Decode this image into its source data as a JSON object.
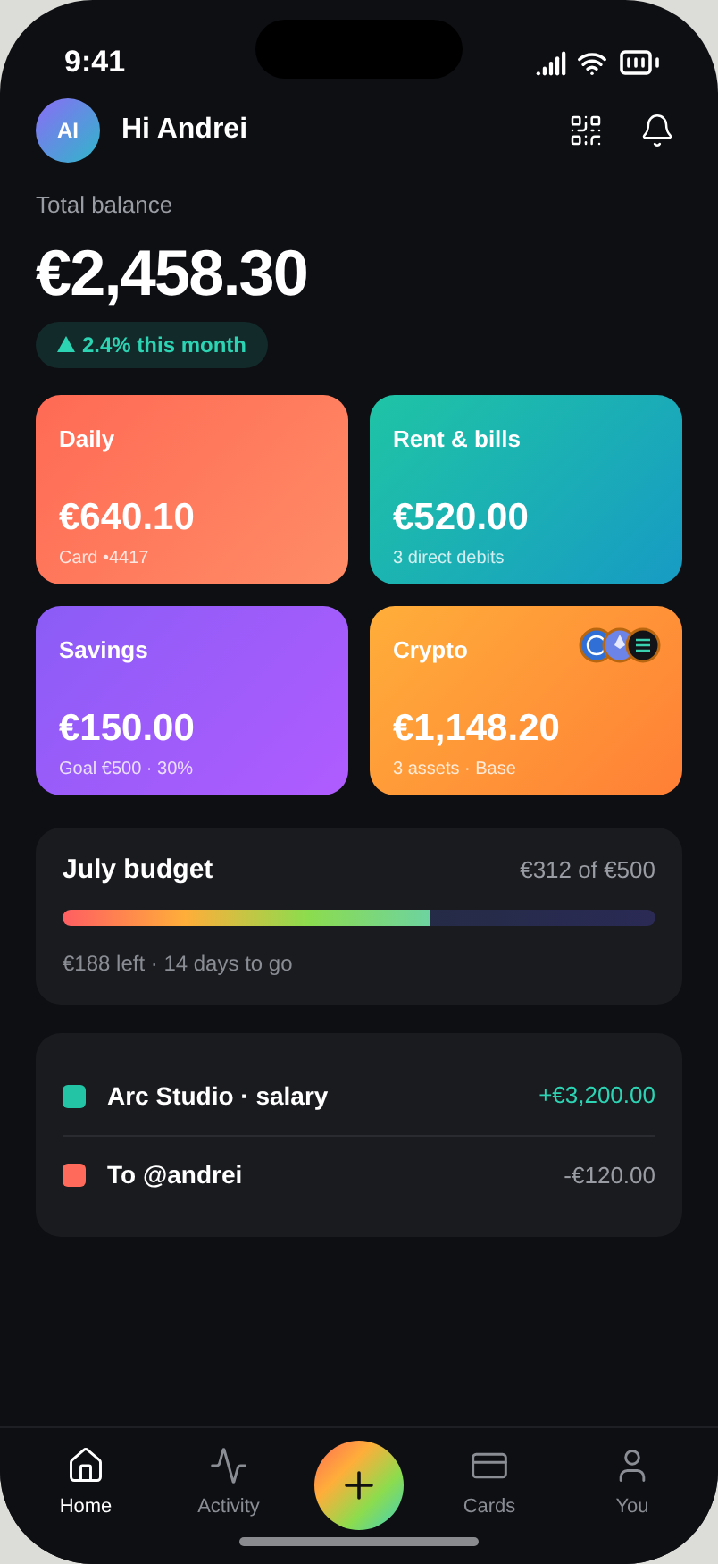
{
  "status_bar": {
    "time": "9:41"
  },
  "header": {
    "avatar_initials": "AI",
    "greeting": "Hi Andrei"
  },
  "balance": {
    "label": "Total balance",
    "amount": "€2,458.30",
    "change": "2.4% this month"
  },
  "accounts": [
    {
      "name": "Daily",
      "amount": "€640.10",
      "detail": "Card •4417",
      "color": "#ff6a55"
    },
    {
      "name": "Rent & bills",
      "amount": "€520.00",
      "detail": "3 direct debits",
      "color": "#1fc4a5"
    },
    {
      "name": "Savings",
      "amount": "€150.00",
      "detail": "Goal €500 · 30%",
      "color": "#8b5cf6"
    },
    {
      "name": "Crypto",
      "amount": "€1,148.20",
      "detail": "3 assets · Base",
      "color": "#ffae3a",
      "coins": true
    }
  ],
  "budget": {
    "title": "July budget",
    "summary": "€312 of €500",
    "level": 0.62,
    "note": "€188 left · 14 days to go"
  },
  "transactions": [
    {
      "name": "Arc Studio · salary",
      "amount": "+€3,200.00",
      "color": "#22c4a5",
      "kind": "credit"
    },
    {
      "name": "To @andrei",
      "amount": "-€120.00",
      "color": "#ff6a5a",
      "kind": "debit"
    }
  ],
  "nav": [
    {
      "label": "Home",
      "kind": "home",
      "selected": true
    },
    {
      "label": "Activity",
      "kind": "activity",
      "selected": false
    },
    {
      "label": "Cards",
      "kind": "cards",
      "selected": false
    },
    {
      "label": "You",
      "kind": "profile",
      "selected": false
    }
  ]
}
